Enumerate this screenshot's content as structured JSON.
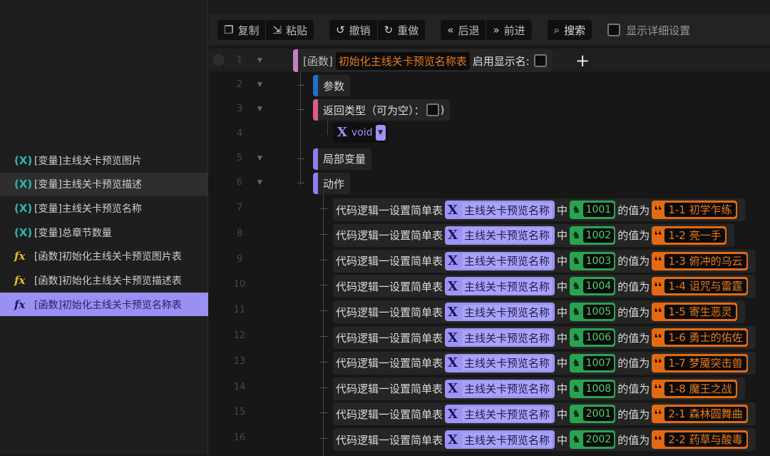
{
  "sidebar": {
    "items": [
      {
        "icon": "variable-icon",
        "label": "[变量]主线关卡预览图片"
      },
      {
        "icon": "variable-icon",
        "label": "[变量]主线关卡预览描述"
      },
      {
        "icon": "variable-icon",
        "label": "[变量]主线关卡预览名称"
      },
      {
        "icon": "variable-icon",
        "label": "[变量]总章节数量"
      },
      {
        "icon": "function-icon",
        "label": "[函数]初始化主线关卡预览图片表"
      },
      {
        "icon": "function-icon",
        "label": "[函数]初始化主线关卡预览描述表"
      },
      {
        "icon": "function-icon",
        "label": "[函数]初始化主线关卡预览名称表"
      }
    ],
    "selected_index": 6,
    "hovered_index": 1
  },
  "toolbar": {
    "copy": "复制",
    "paste": "粘贴",
    "undo": "撤销",
    "redo": "重做",
    "back": "后退",
    "forward": "前进",
    "search": "搜索",
    "show_details": "显示详细设置"
  },
  "editor": {
    "line_numbers": [
      "1",
      "2",
      "3",
      "4",
      "5",
      "6",
      "7",
      "8",
      "9",
      "10",
      "11",
      "12",
      "13",
      "14",
      "15",
      "16"
    ],
    "function_prefix": "[函数]",
    "function_name": "初始化主线关卡预览名称表",
    "enable_display_name": "启用显示名:",
    "params": "参数",
    "return_type": "返回类型（可为空）：",
    "return_close": ")",
    "return_value": "void",
    "locals": "局部变量",
    "actions": "动作",
    "action_label": "代码逻辑一设置简单表",
    "action_in": "中",
    "action_value_of": "的值为",
    "table_var": "主线关卡预览名称",
    "rows": [
      {
        "key": "1001",
        "value": "1-1 初学乍练"
      },
      {
        "key": "1002",
        "value": "1-2 亮一手"
      },
      {
        "key": "1003",
        "value": "1-3 俯冲的乌云"
      },
      {
        "key": "1004",
        "value": "1-4 诅咒与雷霆"
      },
      {
        "key": "1005",
        "value": "1-5 寄生恶灵"
      },
      {
        "key": "1006",
        "value": "1-6 勇士的佑佐"
      },
      {
        "key": "1007",
        "value": "1-7 梦魇突击兽"
      },
      {
        "key": "1008",
        "value": "1-8 魔王之战"
      },
      {
        "key": "2001",
        "value": "2-1 森林圆舞曲"
      },
      {
        "key": "2002",
        "value": "2-2 药草与酸毒"
      }
    ]
  }
}
